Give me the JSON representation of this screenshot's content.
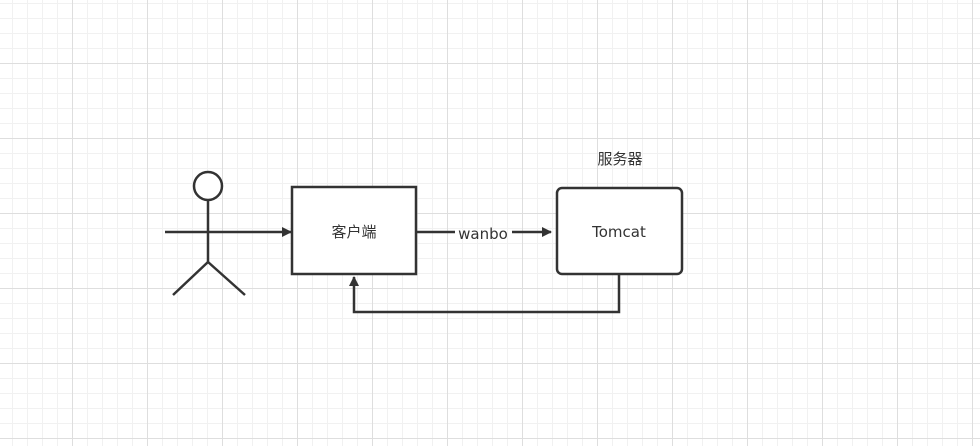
{
  "diagram": {
    "server_group_label": "服务器",
    "client_box_label": "客户端",
    "server_box_label": "Tomcat",
    "edge_label": "wanbo"
  }
}
